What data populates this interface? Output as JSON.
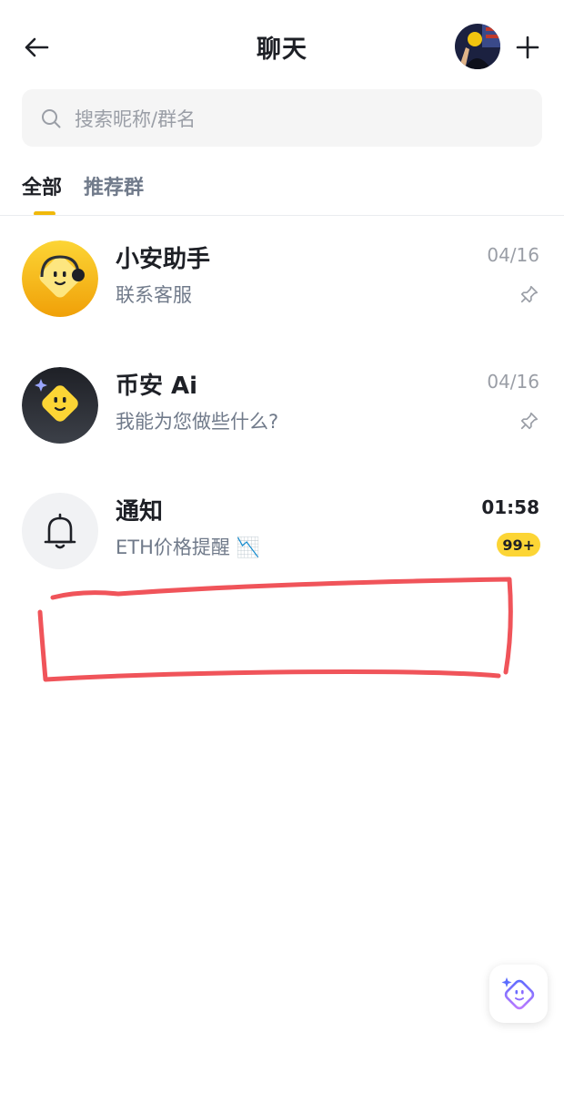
{
  "header": {
    "title": "聊天",
    "back_icon": "arrow-left-icon",
    "add_icon": "plus-icon"
  },
  "search": {
    "placeholder": "搜索昵称/群名",
    "icon": "search-icon"
  },
  "tabs": [
    {
      "label": "全部",
      "active": true
    },
    {
      "label": "推荐群",
      "active": false
    }
  ],
  "chats": [
    {
      "name": "小安助手",
      "subtitle": "联系客服",
      "time": "04/16",
      "pinned": true,
      "avatar_icon": "support-bot-avatar"
    },
    {
      "name": "币安 Ai",
      "subtitle": "我能为您做些什么?",
      "time": "04/16",
      "pinned": true,
      "avatar_icon": "ai-bot-avatar"
    },
    {
      "name": "通知",
      "subtitle": "ETH价格提醒 📉",
      "time": "01:58",
      "unread": "99+",
      "avatar_icon": "bell-icon"
    }
  ],
  "colors": {
    "accent": "#f0b90b",
    "badge": "#fcd535",
    "annotation": "#f0545a",
    "text_primary": "#1e2026",
    "text_secondary": "#707a8a"
  }
}
